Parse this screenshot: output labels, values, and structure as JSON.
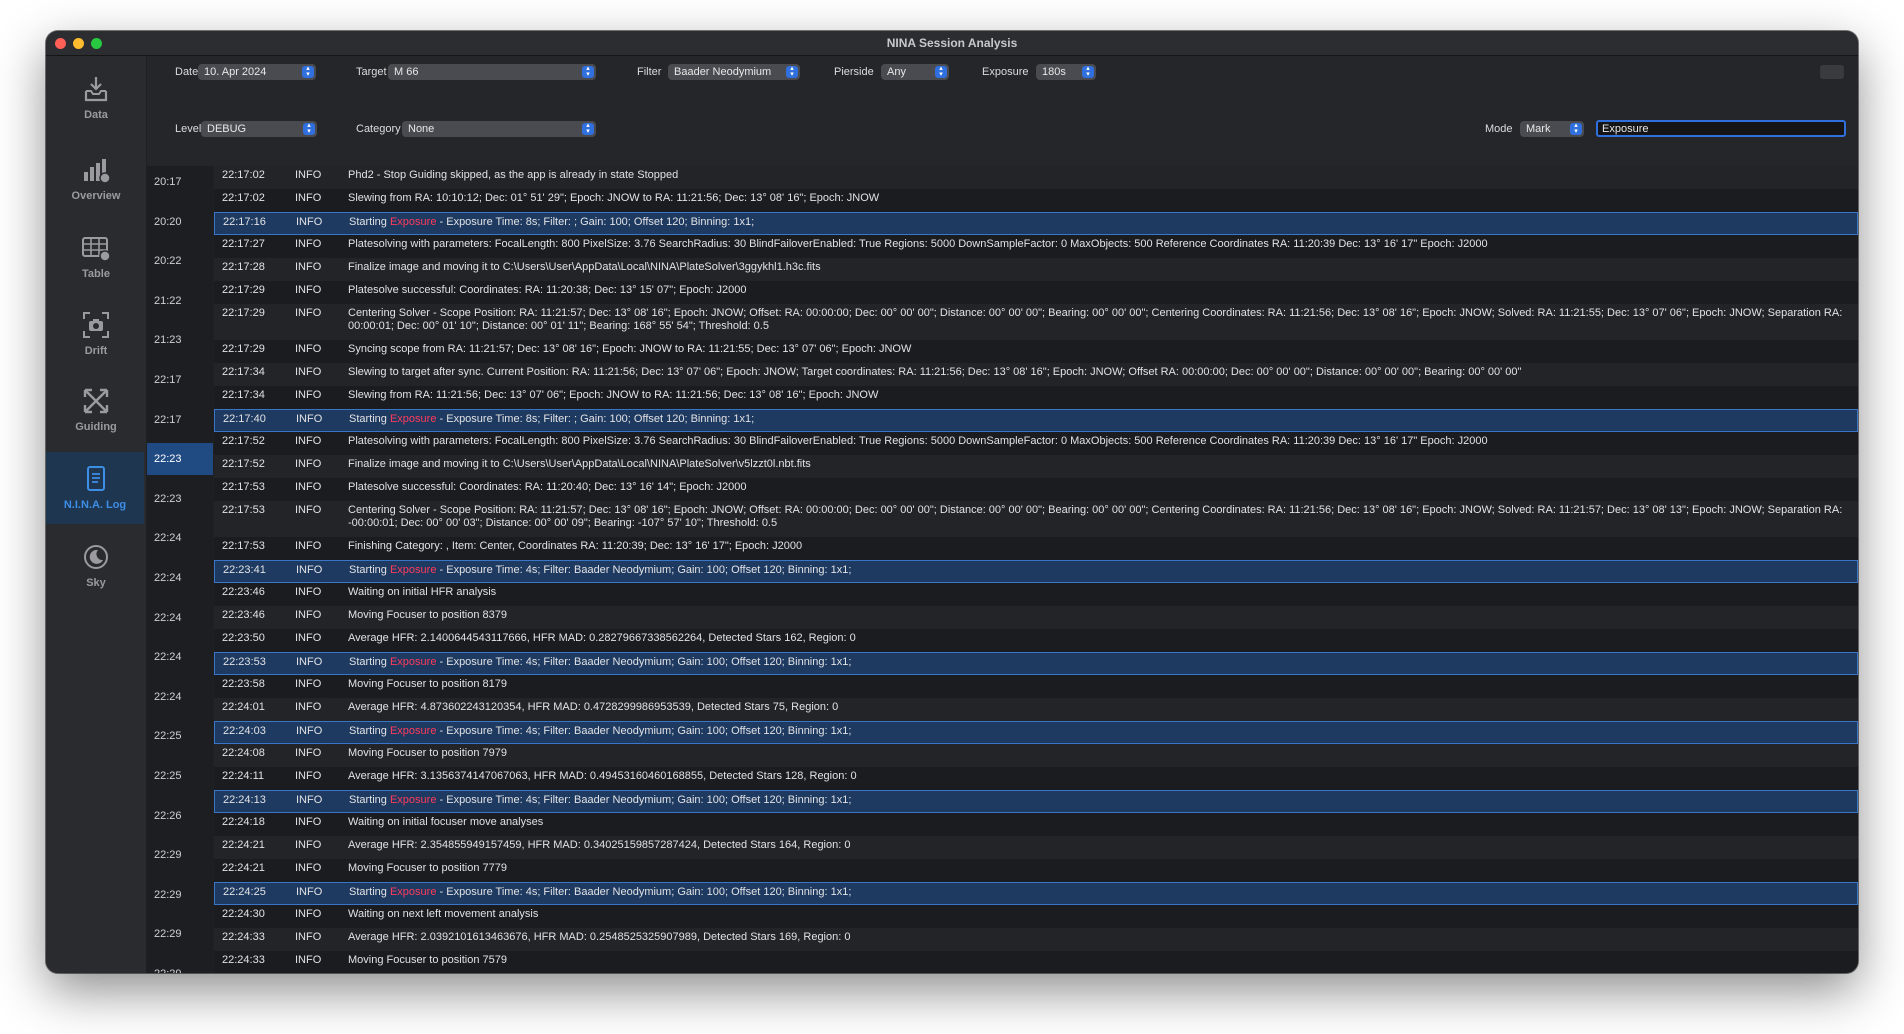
{
  "window": {
    "title": "NINA Session Analysis"
  },
  "sidebar": {
    "items": [
      {
        "label": "Data",
        "icon": "tray-download-icon"
      },
      {
        "label": "Overview",
        "icon": "chart-overview-icon"
      },
      {
        "label": "Table",
        "icon": "table-icon"
      },
      {
        "label": "Drift",
        "icon": "camera-drift-icon"
      },
      {
        "label": "Guiding",
        "icon": "arrows-guiding-icon"
      },
      {
        "label": "N.I.N.A. Log",
        "icon": "document-log-icon",
        "active": true
      },
      {
        "label": "Sky",
        "icon": "moon-sky-icon"
      }
    ]
  },
  "filters": {
    "date_label": "Date",
    "date_value": "10. Apr 2024",
    "target_label": "Target",
    "target_value": "M 66",
    "filter_label": "Filter",
    "filter_value": "Baader Neodymium",
    "pierside_label": "Pierside",
    "pierside_value": "Any",
    "exposure_label": "Exposure",
    "exposure_value": "180s",
    "level_label": "Level",
    "level_value": "DEBUG",
    "category_label": "Category",
    "category_value": "None",
    "mode_label": "Mode",
    "mode_value": "Mark",
    "search_value": "Exposure"
  },
  "timeline": [
    {
      "label": "20:17"
    },
    {
      "label": "20:20"
    },
    {
      "label": "20:22"
    },
    {
      "label": "21:22"
    },
    {
      "label": "21:23"
    },
    {
      "label": "22:17"
    },
    {
      "label": "22:17"
    },
    {
      "label": "22:23",
      "active": true
    },
    {
      "label": "22:23"
    },
    {
      "label": "22:24"
    },
    {
      "label": "22:24"
    },
    {
      "label": "22:24"
    },
    {
      "label": "22:24"
    },
    {
      "label": "22:24"
    },
    {
      "label": "22:25"
    },
    {
      "label": "22:25"
    },
    {
      "label": "22:26"
    },
    {
      "label": "22:29"
    },
    {
      "label": "22:29"
    },
    {
      "label": "22:29"
    },
    {
      "label": "22:29"
    }
  ],
  "log": {
    "keyword": "Exposure",
    "rows": [
      {
        "time": "22:17:02",
        "level": "INFO",
        "message": "Phd2 - Stop Guiding skipped, as the app is already in state Stopped"
      },
      {
        "time": "22:17:02",
        "level": "INFO",
        "message": "Slewing from RA: 10:10:12; Dec: 01° 51' 29\"; Epoch: JNOW to RA: 11:21:56; Dec: 13° 08' 16\"; Epoch: JNOW"
      },
      {
        "time": "22:17:16",
        "level": "INFO",
        "message": "Starting Exposure - Exposure Time: 8s; Filter: ; Gain: 100; Offset 120; Binning: 1x1;",
        "highlight": true
      },
      {
        "time": "22:17:27",
        "level": "INFO",
        "message": "Platesolving with parameters: FocalLength: 800 PixelSize: 3.76 SearchRadius: 30 BlindFailoverEnabled: True Regions: 5000 DownSampleFactor: 0 MaxObjects: 500 Reference Coordinates RA: 11:20:39 Dec: 13° 16' 17\" Epoch: J2000"
      },
      {
        "time": "22:17:28",
        "level": "INFO",
        "message": "Finalize image and moving it to C:\\Users\\User\\AppData\\Local\\NINA\\PlateSolver\\3ggykhl1.h3c.fits"
      },
      {
        "time": "22:17:29",
        "level": "INFO",
        "message": "Platesolve successful: Coordinates: RA: 11:20:38; Dec: 13° 15' 07\"; Epoch: J2000"
      },
      {
        "time": "22:17:29",
        "level": "INFO",
        "message": "Centering Solver - Scope Position: RA: 11:21:57; Dec: 13° 08' 16\"; Epoch: JNOW; Offset: RA: 00:00:00; Dec: 00° 00' 00\"; Distance: 00° 00' 00\"; Bearing: 00° 00' 00\"; Centering Coordinates: RA: 11:21:56; Dec: 13° 08' 16\"; Epoch: JNOW; Solved: RA: 11:21:55; Dec: 13° 07' 06\"; Epoch: JNOW; Separation RA: 00:00:01; Dec: 00° 01' 10\"; Distance: 00° 01' 11\"; Bearing: 168° 55' 54\"; Threshold: 0.5",
        "double": true
      },
      {
        "time": "22:17:29",
        "level": "INFO",
        "message": "Syncing scope from RA: 11:21:57; Dec: 13° 08' 16\"; Epoch: JNOW to RA: 11:21:55; Dec: 13° 07' 06\"; Epoch: JNOW"
      },
      {
        "time": "22:17:34",
        "level": "INFO",
        "message": "Slewing to target after sync. Current Position: RA: 11:21:56; Dec: 13° 07' 06\"; Epoch: JNOW; Target coordinates: RA: 11:21:56; Dec: 13° 08' 16\"; Epoch: JNOW; Offset RA: 00:00:00; Dec: 00° 00' 00\"; Distance: 00° 00' 00\"; Bearing: 00° 00' 00\""
      },
      {
        "time": "22:17:34",
        "level": "INFO",
        "message": "Slewing from RA: 11:21:56; Dec: 13° 07' 06\"; Epoch: JNOW to RA: 11:21:56; Dec: 13° 08' 16\"; Epoch: JNOW"
      },
      {
        "time": "22:17:40",
        "level": "INFO",
        "message": "Starting Exposure - Exposure Time: 8s; Filter: ; Gain: 100; Offset 120; Binning: 1x1;",
        "highlight": true
      },
      {
        "time": "22:17:52",
        "level": "INFO",
        "message": "Platesolving with parameters: FocalLength: 800 PixelSize: 3.76 SearchRadius: 30 BlindFailoverEnabled: True Regions: 5000 DownSampleFactor: 0 MaxObjects: 500 Reference Coordinates RA: 11:20:39 Dec: 13° 16' 17\" Epoch: J2000"
      },
      {
        "time": "22:17:52",
        "level": "INFO",
        "message": "Finalize image and moving it to C:\\Users\\User\\AppData\\Local\\NINA\\PlateSolver\\v5lzzt0l.nbt.fits"
      },
      {
        "time": "22:17:53",
        "level": "INFO",
        "message": "Platesolve successful: Coordinates: RA: 11:20:40; Dec: 13° 16' 14\"; Epoch: J2000"
      },
      {
        "time": "22:17:53",
        "level": "INFO",
        "message": "Centering Solver - Scope Position: RA: 11:21:57; Dec: 13° 08' 16\"; Epoch: JNOW; Offset: RA: 00:00:00; Dec: 00° 00' 00\"; Distance: 00° 00' 00\"; Bearing: 00° 00' 00\"; Centering Coordinates: RA: 11:21:56; Dec: 13° 08' 16\"; Epoch: JNOW; Solved: RA: 11:21:57; Dec: 13° 08' 13\"; Epoch: JNOW; Separation RA: -00:00:01; Dec: 00° 00' 03\"; Distance: 00° 00' 09\"; Bearing: -107° 57' 10\"; Threshold: 0.5",
        "double": true
      },
      {
        "time": "22:17:53",
        "level": "INFO",
        "message": "Finishing Category: , Item: Center, Coordinates RA: 11:20:39; Dec: 13° 16' 17\"; Epoch: J2000"
      },
      {
        "time": "22:23:41",
        "level": "INFO",
        "message": "Starting Exposure - Exposure Time: 4s; Filter: Baader Neodymium; Gain: 100; Offset 120; Binning: 1x1;",
        "highlight": true
      },
      {
        "time": "22:23:46",
        "level": "INFO",
        "message": "Waiting on initial HFR analysis"
      },
      {
        "time": "22:23:46",
        "level": "INFO",
        "message": "Moving Focuser to position 8379"
      },
      {
        "time": "22:23:50",
        "level": "INFO",
        "message": "Average HFR: 2.1400644543117666, HFR MAD: 0.28279667338562264, Detected Stars 162, Region: 0"
      },
      {
        "time": "22:23:53",
        "level": "INFO",
        "message": "Starting Exposure - Exposure Time: 4s; Filter: Baader Neodymium; Gain: 100; Offset 120; Binning: 1x1;",
        "highlight": true
      },
      {
        "time": "22:23:58",
        "level": "INFO",
        "message": "Moving Focuser to position 8179"
      },
      {
        "time": "22:24:01",
        "level": "INFO",
        "message": "Average HFR: 4.873602243120354, HFR MAD: 0.4728299986953539, Detected Stars 75, Region: 0"
      },
      {
        "time": "22:24:03",
        "level": "INFO",
        "message": "Starting Exposure - Exposure Time: 4s; Filter: Baader Neodymium; Gain: 100; Offset 120; Binning: 1x1;",
        "highlight": true
      },
      {
        "time": "22:24:08",
        "level": "INFO",
        "message": "Moving Focuser to position 7979"
      },
      {
        "time": "22:24:11",
        "level": "INFO",
        "message": "Average HFR: 3.1356374147067063, HFR MAD: 0.49453160460168855, Detected Stars 128, Region: 0"
      },
      {
        "time": "22:24:13",
        "level": "INFO",
        "message": "Starting Exposure - Exposure Time: 4s; Filter: Baader Neodymium; Gain: 100; Offset 120; Binning: 1x1;",
        "highlight": true
      },
      {
        "time": "22:24:18",
        "level": "INFO",
        "message": "Waiting on initial focuser move analyses"
      },
      {
        "time": "22:24:21",
        "level": "INFO",
        "message": "Average HFR: 2.354855949157459, HFR MAD: 0.34025159857287424, Detected Stars 164, Region: 0"
      },
      {
        "time": "22:24:21",
        "level": "INFO",
        "message": "Moving Focuser to position 7779"
      },
      {
        "time": "22:24:25",
        "level": "INFO",
        "message": "Starting Exposure - Exposure Time: 4s; Filter: Baader Neodymium; Gain: 100; Offset 120; Binning: 1x1;",
        "highlight": true
      },
      {
        "time": "22:24:30",
        "level": "INFO",
        "message": "Waiting on next left movement analysis"
      },
      {
        "time": "22:24:33",
        "level": "INFO",
        "message": "Average HFR: 2.0392101613463676, HFR MAD: 0.2548525325907989, Detected Stars 169, Region: 0"
      },
      {
        "time": "22:24:33",
        "level": "INFO",
        "message": "Moving Focuser to position 7579"
      }
    ]
  },
  "colors": {
    "accent": "#2f6fde",
    "highlight_row": "#1e3a61",
    "keyword": "#ff3b5c",
    "active_nav": "#3d8ee6"
  }
}
